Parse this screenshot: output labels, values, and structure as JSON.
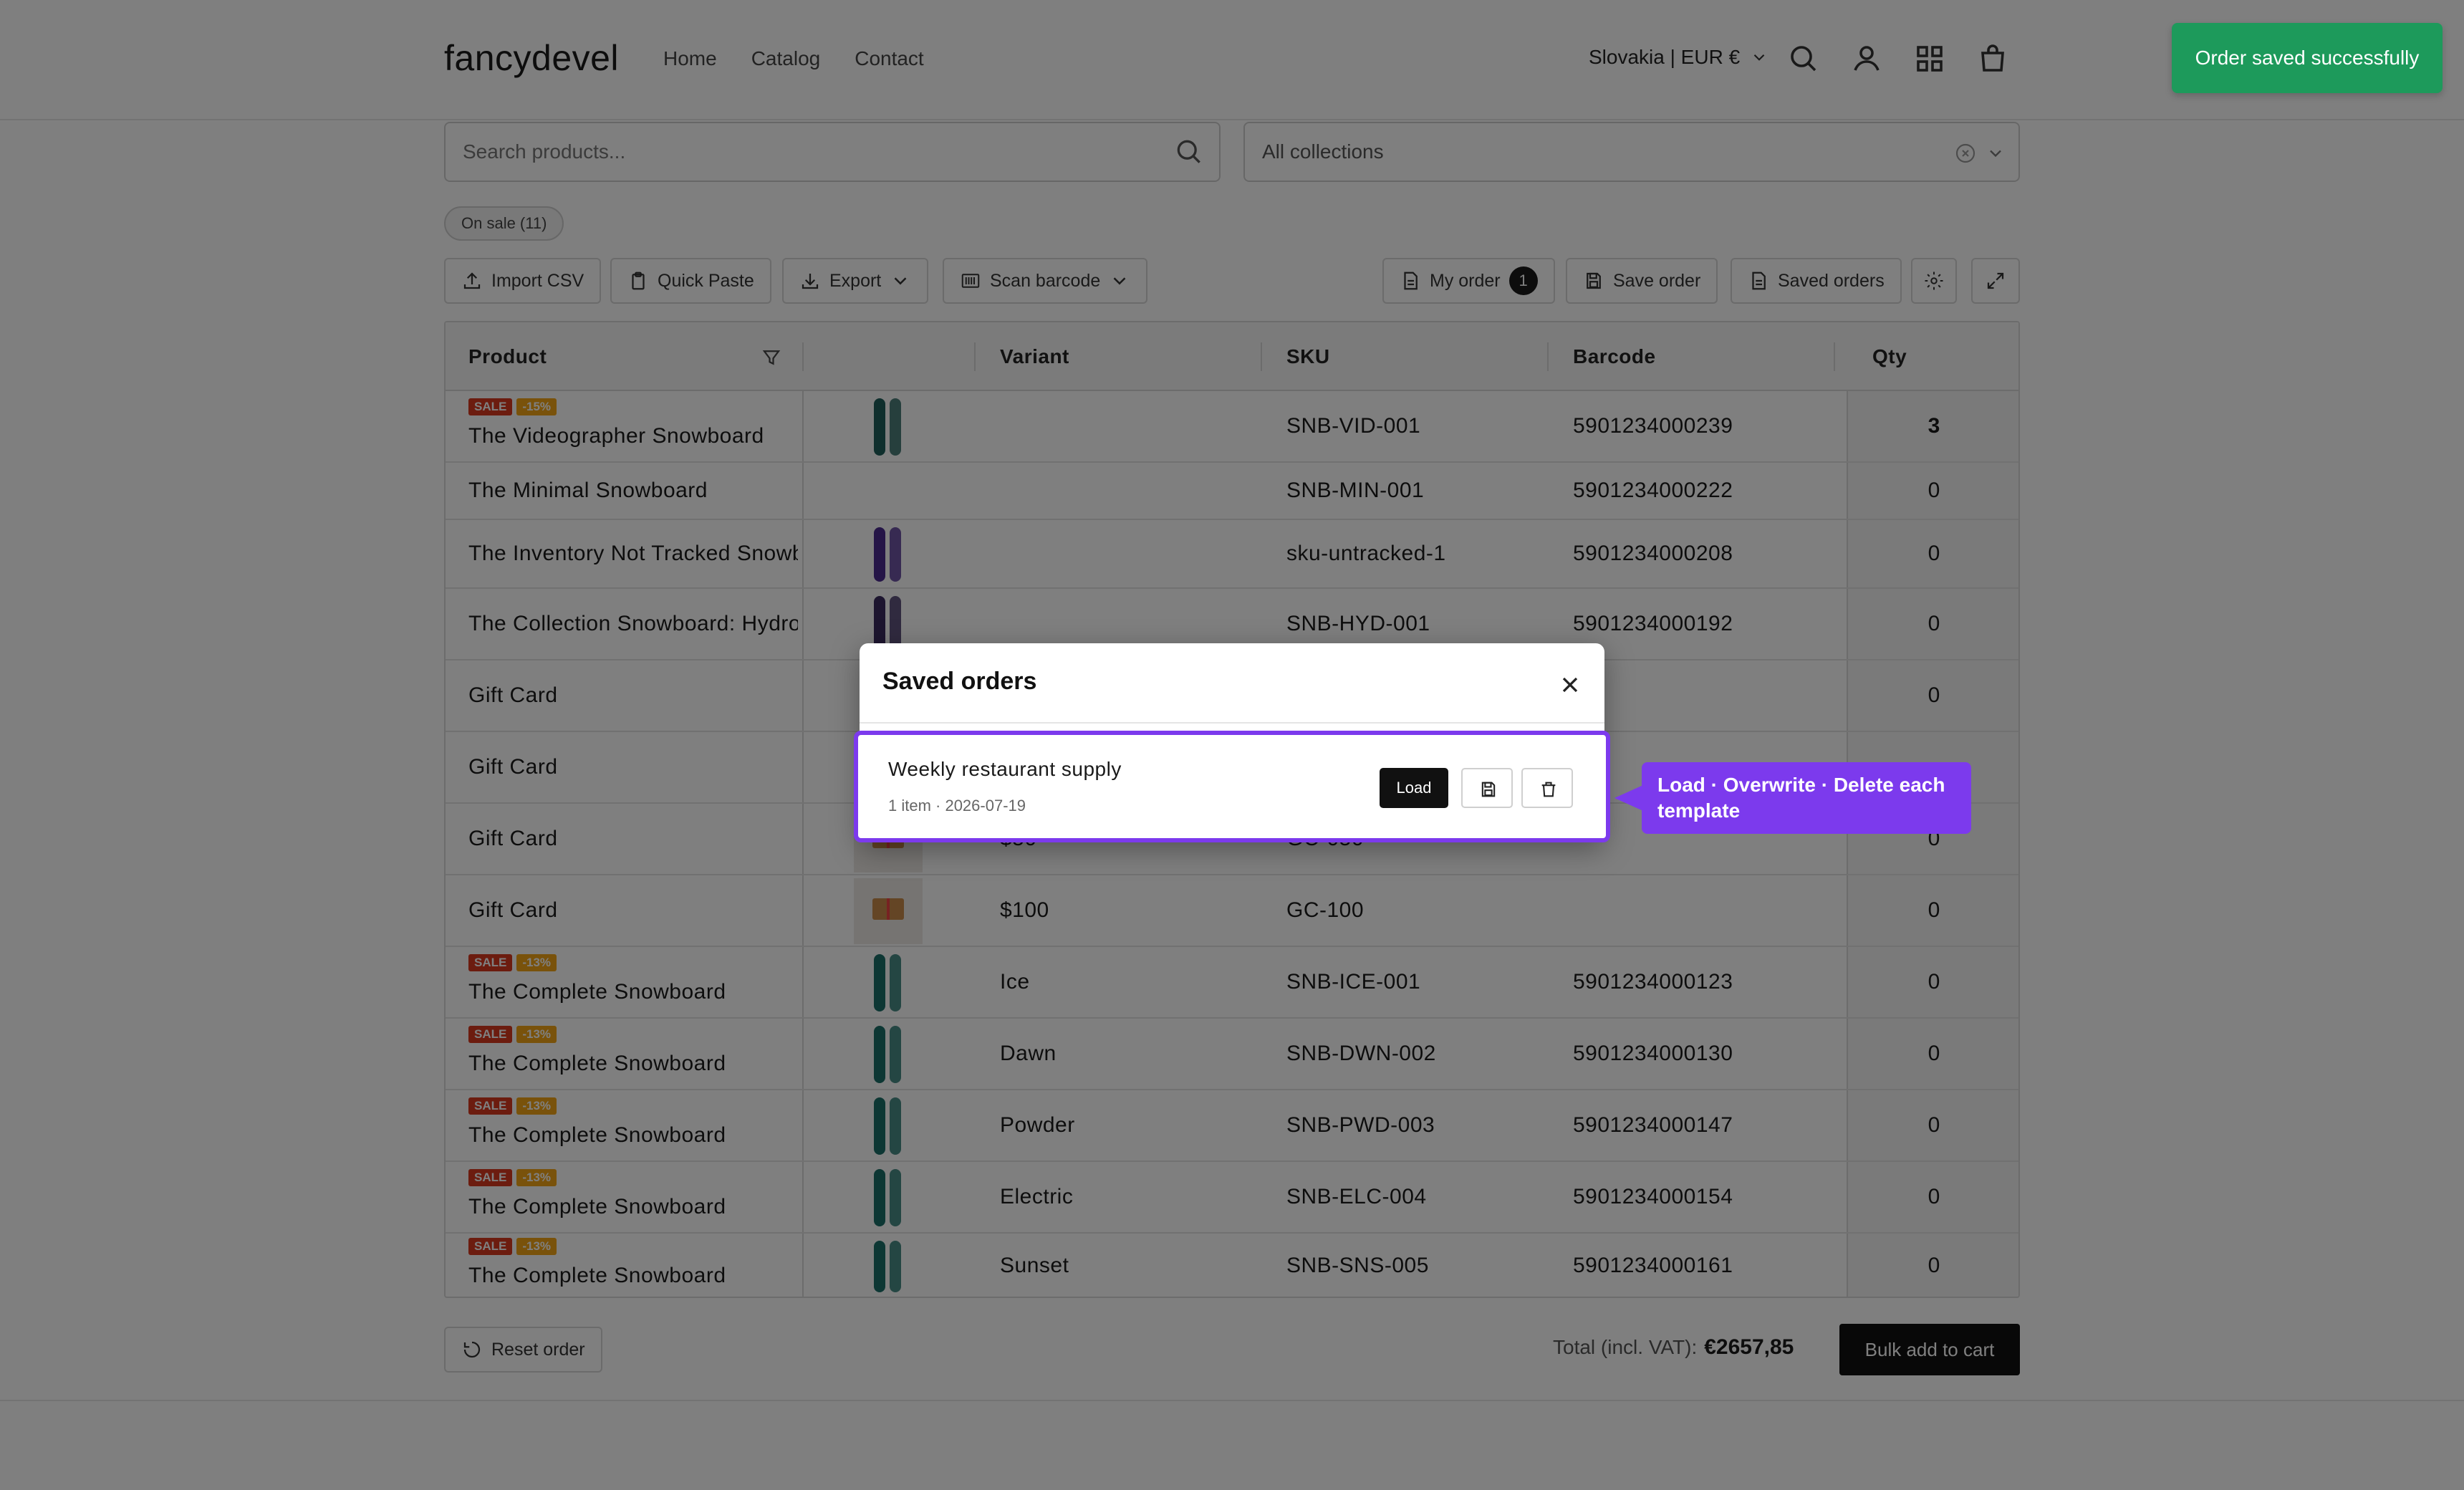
{
  "header": {
    "logo": "fancydevel",
    "nav": [
      "Home",
      "Catalog",
      "Contact"
    ],
    "region": "Slovakia | EUR €"
  },
  "search": {
    "placeholder": "Search products..."
  },
  "collections": {
    "value": "All collections"
  },
  "filter_chip": "On sale (11)",
  "toolbar": {
    "import_csv": "Import CSV",
    "quick_paste": "Quick Paste",
    "export": "Export",
    "scan_barcode": "Scan barcode",
    "my_order": "My order",
    "my_order_count": "1",
    "save_order": "Save order",
    "saved_orders": "Saved orders"
  },
  "table": {
    "headers": {
      "product": "Product",
      "variant": "Variant",
      "sku": "SKU",
      "barcode": "Barcode",
      "qty": "Qty"
    },
    "rows": [
      {
        "name": "The Videographer Snowboard",
        "sale": "SALE",
        "pct": "-15%",
        "variant": "",
        "sku": "SNB-VID-001",
        "barcode": "5901234000239",
        "qty": "3"
      },
      {
        "name": "The Minimal Snowboard",
        "variant": "",
        "sku": "SNB-MIN-001",
        "barcode": "5901234000222",
        "qty": "0"
      },
      {
        "name": "The Inventory Not Tracked Snowboard",
        "variant": "",
        "sku": "sku-untracked-1",
        "barcode": "5901234000208",
        "qty": "0"
      },
      {
        "name": "The Collection Snowboard: Hydrogen",
        "variant": "",
        "sku": "SNB-HYD-001",
        "barcode": "5901234000192",
        "qty": "0"
      },
      {
        "name": "Gift Card",
        "variant": "",
        "sku": "",
        "barcode": "",
        "qty": "0"
      },
      {
        "name": "Gift Card",
        "variant": "",
        "sku": "",
        "barcode": "",
        "qty": ""
      },
      {
        "name": "Gift Card",
        "variant": "$50",
        "sku": "GC-050",
        "barcode": "",
        "qty": "0"
      },
      {
        "name": "Gift Card",
        "variant": "$100",
        "sku": "GC-100",
        "barcode": "",
        "qty": "0"
      },
      {
        "name": "The Complete Snowboard",
        "sale": "SALE",
        "pct": "-13%",
        "variant": "Ice",
        "sku": "SNB-ICE-001",
        "barcode": "5901234000123",
        "qty": "0"
      },
      {
        "name": "The Complete Snowboard",
        "sale": "SALE",
        "pct": "-13%",
        "variant": "Dawn",
        "sku": "SNB-DWN-002",
        "barcode": "5901234000130",
        "qty": "0"
      },
      {
        "name": "The Complete Snowboard",
        "sale": "SALE",
        "pct": "-13%",
        "variant": "Powder",
        "sku": "SNB-PWD-003",
        "barcode": "5901234000147",
        "qty": "0"
      },
      {
        "name": "The Complete Snowboard",
        "sale": "SALE",
        "pct": "-13%",
        "variant": "Electric",
        "sku": "SNB-ELC-004",
        "barcode": "5901234000154",
        "qty": "0"
      },
      {
        "name": "The Complete Snowboard",
        "sale": "SALE",
        "pct": "-13%",
        "variant": "Sunset",
        "sku": "SNB-SNS-005",
        "barcode": "5901234000161",
        "qty": "0"
      }
    ]
  },
  "footer": {
    "reset": "Reset order",
    "total_label": "Total (incl. VAT):",
    "total_value": "€2657,85",
    "bulk": "Bulk add to cart"
  },
  "toast": "Order saved successfully",
  "modal": {
    "title": "Saved orders",
    "order_name": "Weekly restaurant supply",
    "order_meta": "1 item · 2026-07-19",
    "load": "Load"
  },
  "tooltip": "Load · Overwrite · Delete each template",
  "colors": {
    "accent": "#7c3aed",
    "toast": "#1d9a5b",
    "sale": "#d9381e",
    "discount": "#f2a516"
  }
}
